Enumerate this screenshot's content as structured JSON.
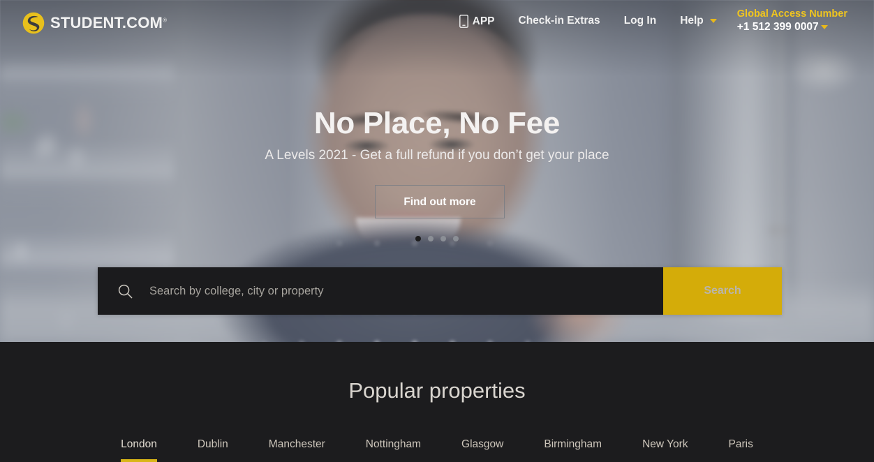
{
  "header": {
    "logo": {
      "text": "STUDENT.COM",
      "trademark": "®",
      "mark_color": "#e8c01c",
      "icon": "student-s-logo-icon"
    },
    "nav": [
      {
        "label": "APP",
        "icon": "mobile-phone-icon",
        "has_caret": false
      },
      {
        "label": "Check-in Extras",
        "icon": "",
        "has_caret": false
      },
      {
        "label": "Log In",
        "icon": "",
        "has_caret": false
      },
      {
        "label": "Help",
        "icon": "",
        "has_caret": true
      }
    ],
    "global_access": {
      "title": "Global Access Number",
      "number": "+1 512 399 0007",
      "title_color": "#f0c51e",
      "caret_icon": "chevron-down-icon"
    }
  },
  "hero": {
    "title": "No Place, No Fee",
    "subtitle": "A Levels 2021 - Get a full refund if you don’t get your place",
    "cta_label": "Find out more",
    "carousel": {
      "total": 4,
      "active_index": 0,
      "active_color": "#1d1d1d",
      "inactive_color": "#8b8f96"
    }
  },
  "search": {
    "placeholder": "Search by college, city or property",
    "value": "",
    "icon": "search-icon",
    "button_label": "Search",
    "button_color": "#d4ac09"
  },
  "popular": {
    "title": "Popular properties",
    "active_city": "London",
    "underline_color": "#d9b618",
    "cities": [
      {
        "label": "London"
      },
      {
        "label": "Dublin"
      },
      {
        "label": "Manchester"
      },
      {
        "label": "Nottingham"
      },
      {
        "label": "Glasgow"
      },
      {
        "label": "Birmingham"
      },
      {
        "label": "New York"
      },
      {
        "label": "Paris"
      }
    ]
  }
}
